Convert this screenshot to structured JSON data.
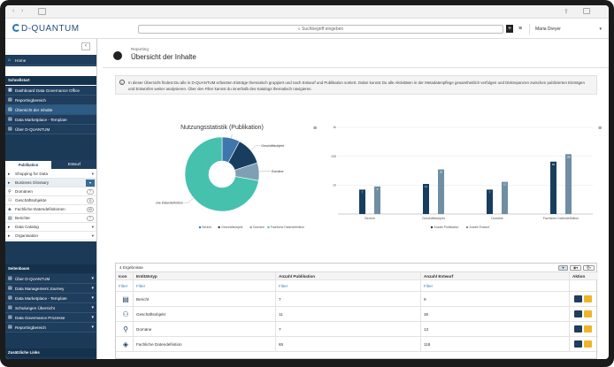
{
  "browser": {
    "back_icon": "chevron-left-icon",
    "forward_icon": "chevron-right-icon",
    "sidebar_toggle_icon": "sidebar-icon",
    "share_icon": "share-icon",
    "tabs_icon": "tabs-icon"
  },
  "header": {
    "logo": "D-QUANTUM",
    "search_placeholder": "Suchbegriff eingeben",
    "add_label": "+",
    "user_name": "Maria Dreyer"
  },
  "sidebar": {
    "home": "Home",
    "section_schnellstart": "Schnellstart",
    "quick_items": [
      "Dashboard Data Governance Office",
      "Reportingbereich",
      "Übersicht der Inhalte",
      "Data Marketplace - Template",
      "Über D-QUANTUM"
    ],
    "tabs": [
      "Publikation",
      "Entwurf"
    ],
    "catalog_items": [
      {
        "label": "Shopping for Data",
        "count": ""
      },
      {
        "label": "Business Glossary",
        "count": ""
      },
      {
        "label": "Domänen",
        "count": "7"
      },
      {
        "label": "Geschäftsobjekte",
        "count": "11"
      },
      {
        "label": "Fachliche Datendefinitionen",
        "count": "65"
      },
      {
        "label": "Berichte",
        "count": "7"
      },
      {
        "label": "Data Catalog",
        "count": ""
      },
      {
        "label": "Organisation",
        "count": ""
      }
    ],
    "section_seitenbaum": "Seitenbaum",
    "tree_items": [
      "Über D-QUANTUM",
      "Data Management Journey",
      "Data Marketplace - Template",
      "Schulungen Übersicht",
      "Data Governance Prozesse",
      "Reportingbereich"
    ],
    "section_links": "Zusätzliche Links"
  },
  "page": {
    "breadcrumb": "Reporting",
    "title": "Übersicht der Inhalte",
    "info_text": "In dieser Übersicht findest Du alle in D-QUANTUM erfassten Einträge thematisch gruppiert und nach Entwurf und Publikation sortiert. Dabei konnst Du alle Aktivitäten in der Metadatenpflege gesamtheitlich verfolgen und Diskrepanzen zwischen publizierten Einträgen und Entwürfen weiter analysieren. Über den Filter kannst du innerhalb des Katalogs thematisch navigieren."
  },
  "chart_data": [
    {
      "type": "pie",
      "title": "Nutzungsstatistik (Publikation)",
      "categories": [
        "Bericht",
        "Geschäftsobjekt",
        "Domäne",
        "Fachliche Datendefinition"
      ],
      "values": [
        7,
        11,
        7,
        65
      ],
      "colors": [
        "#3f76ad",
        "#173e5e",
        "#7f9fb4",
        "#45c1ae"
      ],
      "legend": "bottom"
    },
    {
      "type": "bar",
      "title": "",
      "categories": [
        "Bericht",
        "Geschäftsobjekt",
        "Domäne",
        "Fachliche Datendefinition"
      ],
      "series": [
        {
          "name": "Anzahl Publikation",
          "values": [
            7,
            11,
            7,
            65
          ],
          "color": "#173e5e"
        },
        {
          "name": "Anzahl Entwurf",
          "values": [
            9,
            35,
            13,
            118
          ],
          "color": "#6e8ea3"
        }
      ],
      "yscale": "log",
      "ylim": [
        1,
        1000
      ],
      "yticks": [
        "10",
        "100",
        "1k"
      ],
      "legend": "bottom"
    }
  ],
  "table": {
    "result_count": "4 Ergebnisse",
    "columns": [
      "Icon",
      "Entitätstyp",
      "Anzahl Publikation",
      "Anzahl Entwurf",
      "Aktion"
    ],
    "filter_label": "Filter",
    "rows": [
      {
        "icon": "report-icon",
        "type": "Bericht",
        "pub": "7",
        "draft": "9"
      },
      {
        "icon": "business-object-icon",
        "type": "Geschäftsobjekt",
        "pub": "11",
        "draft": "35"
      },
      {
        "icon": "domain-icon",
        "type": "Domäne",
        "pub": "7",
        "draft": "13"
      },
      {
        "icon": "tag-icon",
        "type": "Fachliche Datendefinition",
        "pub": "65",
        "draft": "118"
      }
    ]
  }
}
